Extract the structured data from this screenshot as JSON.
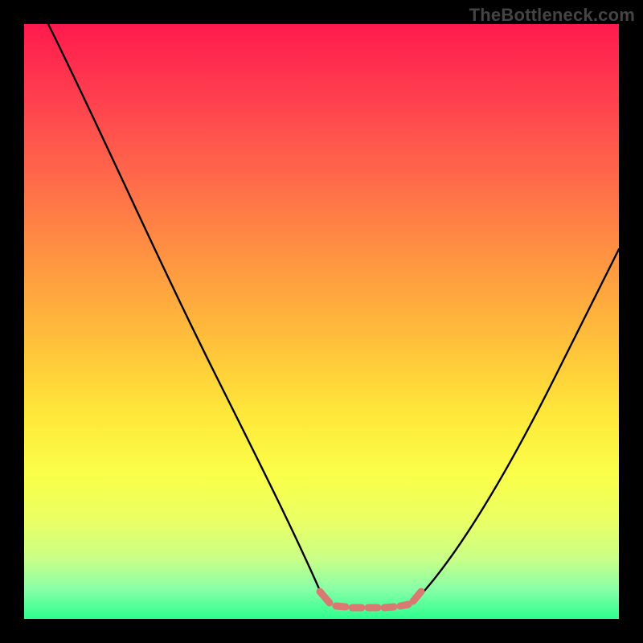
{
  "watermark": "TheBottleneck.com",
  "chart_data": {
    "type": "line",
    "title": "",
    "xlabel": "",
    "ylabel": "",
    "xlim": [
      0,
      100
    ],
    "ylim": [
      0,
      100
    ],
    "grid": false,
    "legend": false,
    "annotations": [],
    "series": [
      {
        "name": "left-curve",
        "color": "#000000",
        "x": [
          4,
          10,
          16,
          22,
          28,
          34,
          40,
          46,
          50
        ],
        "y": [
          100,
          85,
          70,
          56,
          42,
          28,
          16,
          6,
          2
        ]
      },
      {
        "name": "right-curve",
        "color": "#000000",
        "x": [
          66,
          72,
          78,
          84,
          90,
          96,
          100
        ],
        "y": [
          2,
          6,
          14,
          24,
          36,
          48,
          56
        ]
      },
      {
        "name": "bottom-flat",
        "color": "#d97a72",
        "x": [
          50,
          53,
          56,
          59,
          62,
          65,
          66
        ],
        "y": [
          2,
          1.5,
          1.4,
          1.4,
          1.5,
          1.8,
          2
        ]
      }
    ],
    "colors": {
      "background_top": "#ff1a4d",
      "background_mid": "#ffe93a",
      "background_bottom": "#2cff8e",
      "curve": "#000000",
      "flat_segment": "#d97a72",
      "frame": "#000000"
    }
  }
}
